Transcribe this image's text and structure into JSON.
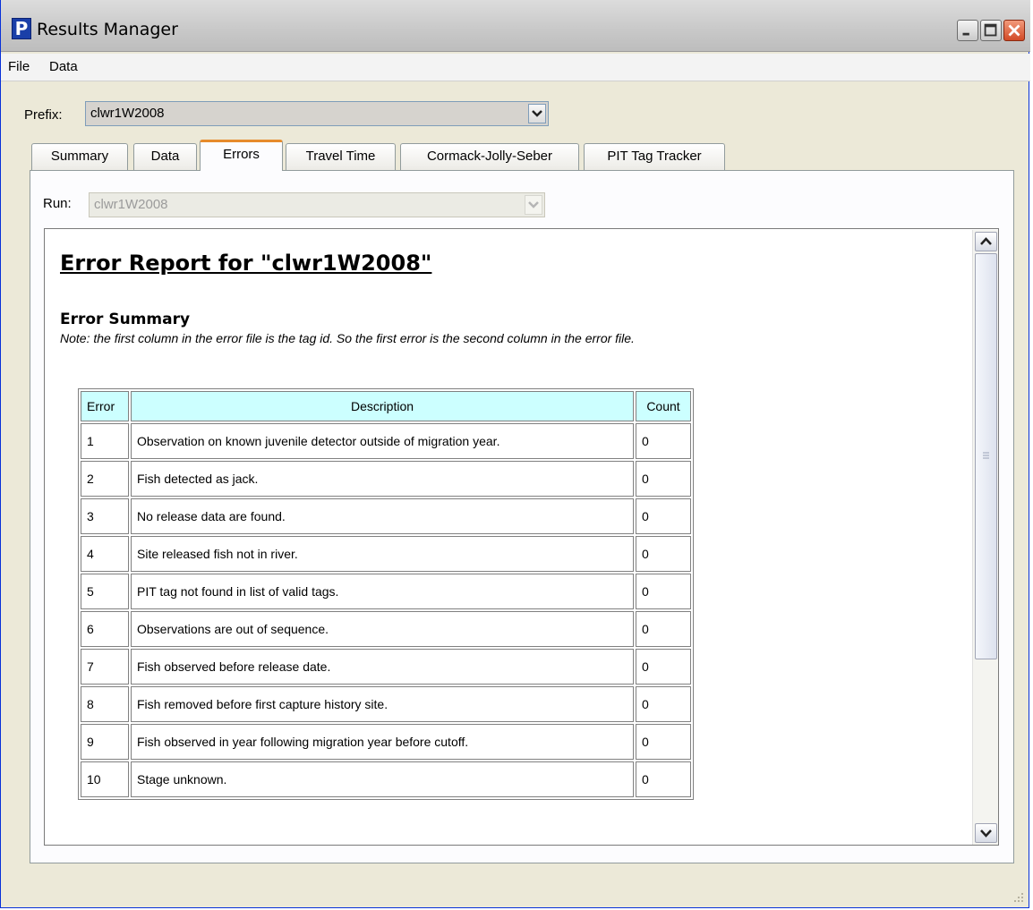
{
  "window": {
    "title": "Results Manager",
    "app_icon_letter": "P"
  },
  "menu": [
    "File",
    "Data"
  ],
  "prefix": {
    "label": "Prefix:",
    "value": "clwr1W2008"
  },
  "tabs": [
    "Summary",
    "Data",
    "Errors",
    "Travel Time",
    "Cormack-Jolly-Seber",
    "PIT Tag Tracker"
  ],
  "active_tab": "Errors",
  "run": {
    "label": "Run:",
    "value": "clwr1W2008",
    "disabled": true
  },
  "report": {
    "title": "Error Report for \"clwr1W2008\"",
    "summary_heading": "Error Summary",
    "note": "Note: the first column in the error file is the tag id. So the first error is the second column in the error file.",
    "columns": [
      "Error",
      "Description",
      "Count"
    ],
    "rows": [
      {
        "error": "1",
        "description": "Observation on known juvenile detector outside of migration year.",
        "count": "0"
      },
      {
        "error": "2",
        "description": "Fish detected as jack.",
        "count": "0"
      },
      {
        "error": "3",
        "description": "No release data are found.",
        "count": "0"
      },
      {
        "error": "4",
        "description": "Site released fish not in river.",
        "count": "0"
      },
      {
        "error": "5",
        "description": "PIT tag not found in list of valid tags.",
        "count": "0"
      },
      {
        "error": "6",
        "description": "Observations are out of sequence.",
        "count": "0"
      },
      {
        "error": "7",
        "description": "Fish observed before release date.",
        "count": "0"
      },
      {
        "error": "8",
        "description": "Fish removed before first capture history site.",
        "count": "0"
      },
      {
        "error": "9",
        "description": "Fish observed in year following migration year before cutoff.",
        "count": "0"
      },
      {
        "error": "10",
        "description": "Stage unknown.",
        "count": "0"
      }
    ]
  },
  "colors": {
    "table_header_bg": "#ccffff",
    "active_tab_accent": "#e68b2c",
    "close_button": "#d24a26"
  }
}
